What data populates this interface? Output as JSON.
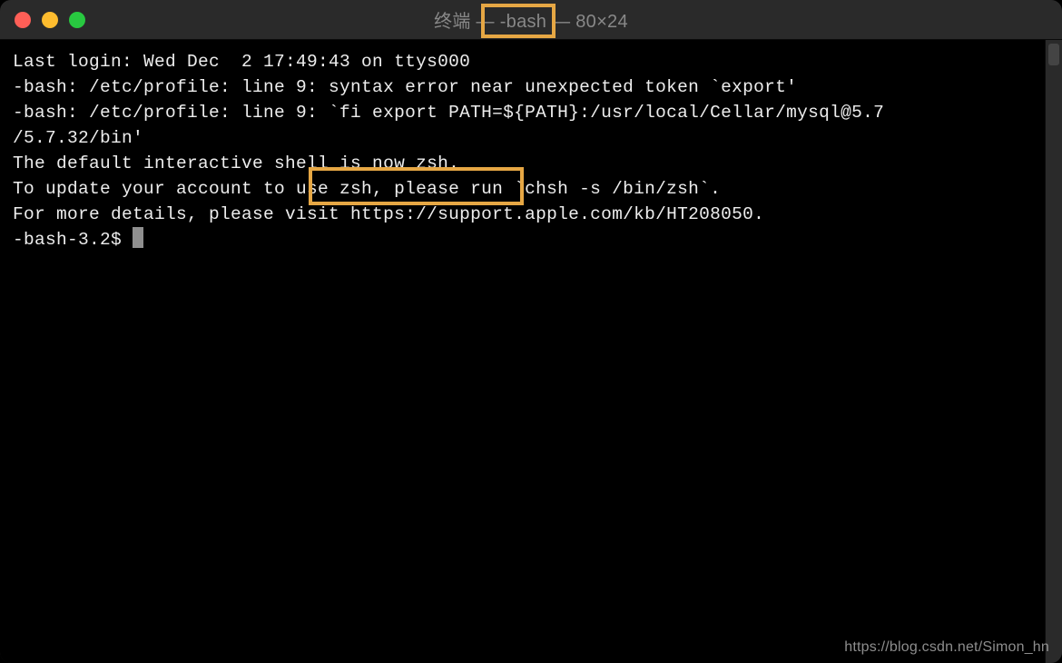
{
  "window": {
    "title": "终端 — -bash — 80×24"
  },
  "terminal": {
    "lines": [
      "Last login: Wed Dec  2 17:49:43 on ttys000",
      "-bash: /etc/profile: line 9: syntax error near unexpected token `export'",
      "-bash: /etc/profile: line 9: `fi export PATH=${PATH}:/usr/local/Cellar/mysql@5.7",
      "/5.7.32/bin'",
      "",
      "The default interactive shell is now zsh.",
      "To update your account to use zsh, please run `chsh -s /bin/zsh`.",
      "For more details, please visit https://support.apple.com/kb/HT208050."
    ],
    "prompt": "-bash-3.2$ "
  },
  "watermark": "https://blog.csdn.net/Simon_hn"
}
